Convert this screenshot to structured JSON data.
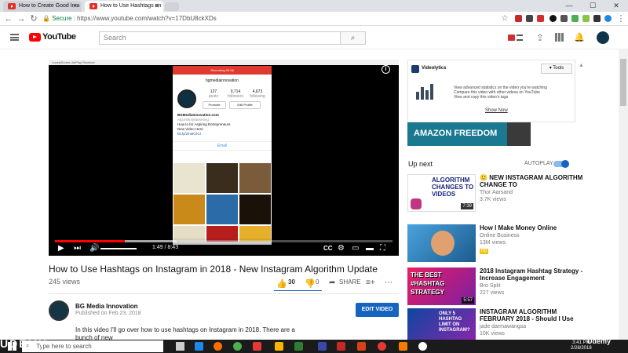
{
  "browser": {
    "tabs": [
      {
        "title": "How to Create Good Ima",
        "active": false
      },
      {
        "title": "How to Use Hashtags on",
        "active": true
      }
    ],
    "security_label": "Secure",
    "url": "https://www.youtube.com/watch?v=17DbU8ckXDs"
  },
  "youtube": {
    "logo": "YouTube",
    "search_placeholder": "Search"
  },
  "player": {
    "capture_title": "LonelyScreen AirPlay Receiver",
    "recording_label": "Recording 00:08",
    "time": "1:49 / 8:43",
    "progress": 0.208,
    "buffered": 0.36,
    "phone": {
      "username": "bgmediainnovation",
      "stats": [
        {
          "value": "127",
          "label": "posts"
        },
        {
          "value": "9,714",
          "label": "followers"
        },
        {
          "value": "4,673",
          "label": "following"
        }
      ],
      "promote_label": "Promote",
      "edit_label": "Edit Profile",
      "bio": [
        "BGMediaInnovation.com",
        "Algorithm|Marketing",
        "How to for Aspiring Entrepreneurs",
        "New Video Here",
        "bit.ly/2msKOCl"
      ],
      "email_label": "Email"
    }
  },
  "video": {
    "title": "How to Use Hashtags on Instagram in 2018 - New Instagram Algorithm Update",
    "views": "245 views",
    "likes": "30",
    "dislikes": "0",
    "share_label": "SHARE",
    "channel": "BG Media Innovation",
    "published": "Published on Feb 23, 2018",
    "edit_label": "EDIT VIDEO",
    "description": "In this video I'll go over how to use hashtags on Instagram in 2018. There are a bunch of new"
  },
  "vidlytics": {
    "brand": "Videolytics",
    "tools_label": "Tools",
    "bullets": [
      "View advanced statistics on the video you're watching",
      "Compare this video with other videos on YouTube",
      "View and copy this video's tags"
    ],
    "cta": "Show Now"
  },
  "ad": {
    "text": "AMAZON FREEDOM"
  },
  "sidebar": {
    "up_next": "Up next",
    "autoplay": "AUTOPLAY",
    "recs": [
      {
        "title": "NEW INSTAGRAM ALGORITHM CHANGE TO",
        "channel": "Thor Aarsand",
        "views": "3.7K views",
        "duration": "7:39",
        "badge": ""
      },
      {
        "title": "How I Make Money Online",
        "channel": "Online Business",
        "views": "13M views",
        "duration": "",
        "badge": "HD"
      },
      {
        "title": "2018 Instagram Hashtag Strategy - Increase Engagement",
        "channel": "Bro Split",
        "views": "227 views",
        "duration": "5:57",
        "badge": ""
      },
      {
        "title": "INSTAGRAM ALGORITHM FEBRUARY 2018 - Should I Use",
        "channel": "jade darmawangsa",
        "views": "10K views",
        "duration": "",
        "badge": ""
      }
    ],
    "thumb_texts": [
      "ALGORITHM CHANGES TO VIDEOS",
      "",
      "THE BEST #HASHTAG STRATEGY",
      "ONLY 5 HASHTAG LIMIT ON INSTAGRAM?"
    ]
  },
  "taskbar": {
    "search_placeholder": "Type here to search",
    "time": "3:41 PM",
    "date": "2/28/2018"
  },
  "watermark": "Udemy",
  "watermark_left": "UDEMY"
}
